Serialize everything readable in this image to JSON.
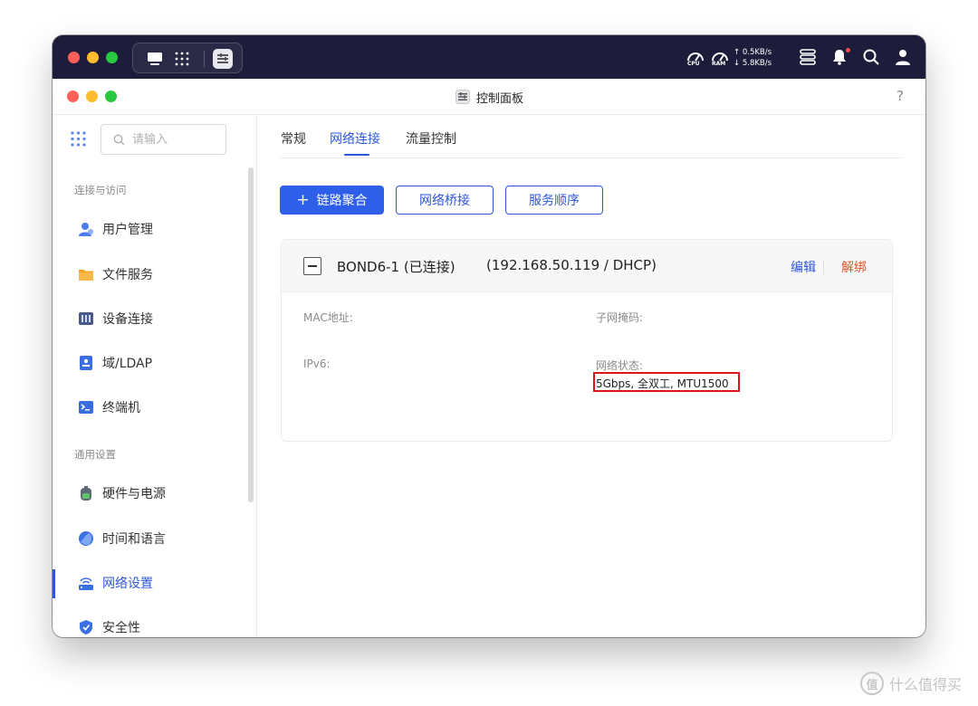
{
  "os_bar": {
    "cpu_label": "CPU",
    "ram_label": "RAM",
    "upload_speed": "0.5KB/s",
    "download_speed": "5.8KB/s",
    "up_arrow": "↑",
    "down_arrow": "↓",
    "notification_dot_color": "#ff4d4f"
  },
  "window": {
    "title": "控制面板",
    "help": "?"
  },
  "sidebar": {
    "search_placeholder": "请输入",
    "groups": [
      {
        "title": "连接与访问"
      },
      {
        "title": "通用设置"
      }
    ],
    "items": [
      {
        "label": "用户管理",
        "icon": "user-icon"
      },
      {
        "label": "文件服务",
        "icon": "folder-icon"
      },
      {
        "label": "设备连接",
        "icon": "device-icon"
      },
      {
        "label": "域/LDAP",
        "icon": "domain-icon"
      },
      {
        "label": "终端机",
        "icon": "terminal-icon"
      },
      {
        "label": "硬件与电源",
        "icon": "battery-icon"
      },
      {
        "label": "时间和语言",
        "icon": "globe-icon"
      },
      {
        "label": "网络设置",
        "icon": "network-icon",
        "active": true
      },
      {
        "label": "安全性",
        "icon": "shield-icon"
      }
    ]
  },
  "tabs": [
    {
      "label": "常规"
    },
    {
      "label": "网络连接",
      "active": true
    },
    {
      "label": "流量控制"
    }
  ],
  "actions": {
    "link_aggregation": "链路聚合",
    "network_bridge": "网络桥接",
    "service_order": "服务顺序"
  },
  "bond": {
    "name": "BOND6-1 (已连接)",
    "address": "(192.168.50.119 / DHCP)",
    "edit": "编辑",
    "unbind": "解绑",
    "fields": {
      "mac_label": "MAC地址:",
      "mask_label": "子网掩码:",
      "ipv6_label": "IPv6:",
      "status_label": "网络状态:",
      "status_value": "5Gbps, 全双工, MTU1500"
    }
  },
  "colors": {
    "accent": "#2e57d8",
    "danger": "#e0562b",
    "highlight": "#e0131a"
  },
  "watermark": {
    "icon_char": "值",
    "text": "什么值得买"
  }
}
